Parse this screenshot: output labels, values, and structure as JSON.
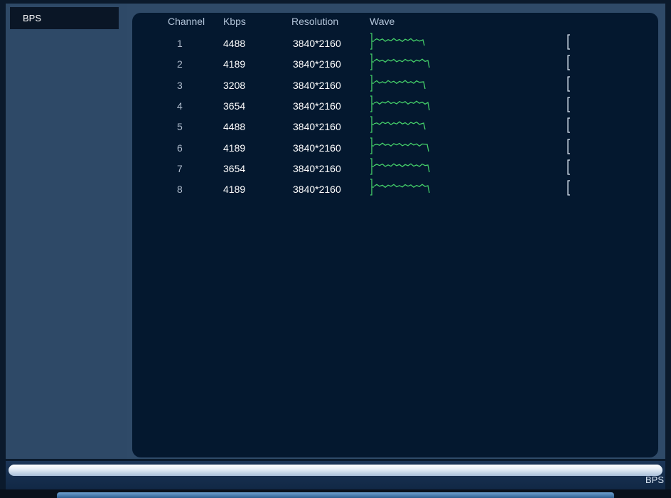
{
  "sidebar": {
    "items": [
      {
        "label": "BPS"
      }
    ]
  },
  "table": {
    "columns": [
      "Channel",
      "Kbps",
      "Resolution",
      "Wave"
    ],
    "rows": [
      {
        "channel": "1",
        "kbps": "4488",
        "resolution": "3840*2160"
      },
      {
        "channel": "2",
        "kbps": "4189",
        "resolution": "3840*2160"
      },
      {
        "channel": "3",
        "kbps": "3208",
        "resolution": "3840*2160"
      },
      {
        "channel": "4",
        "kbps": "3654",
        "resolution": "3840*2160"
      },
      {
        "channel": "5",
        "kbps": "4488",
        "resolution": "3840*2160"
      },
      {
        "channel": "6",
        "kbps": "4189",
        "resolution": "3840*2160"
      },
      {
        "channel": "7",
        "kbps": "3654",
        "resolution": "3840*2160"
      },
      {
        "channel": "8",
        "kbps": "4189",
        "resolution": "3840*2160"
      }
    ]
  },
  "footer": {
    "label": "BPS",
    "progress": 1.0
  },
  "colors": {
    "wave": "#45d16a",
    "panel": "#04182f",
    "frame": "#2f4a68"
  }
}
